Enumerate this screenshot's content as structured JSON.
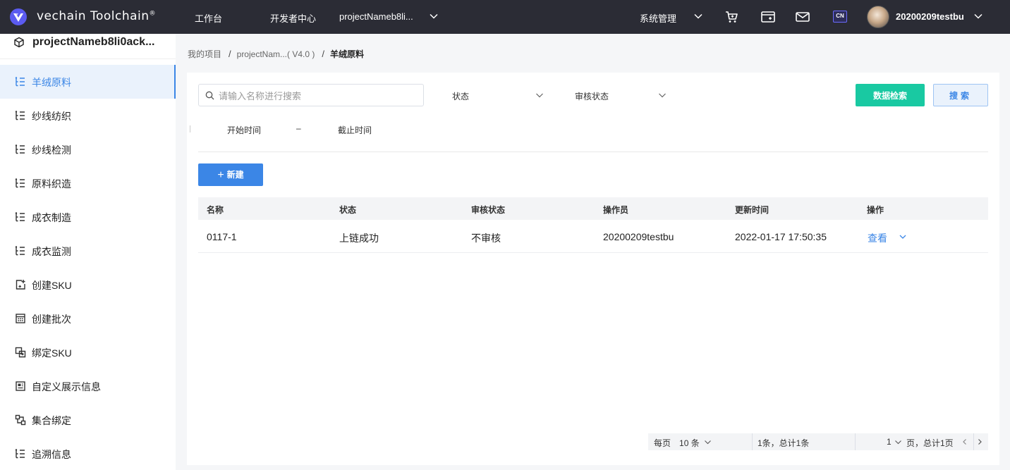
{
  "topbar": {
    "brand": "vechain Toolchain",
    "brand_mark": "®",
    "nav": {
      "workbench": "工作台",
      "dev_center": "开发者中心",
      "project_select": "projectNameb8li..."
    },
    "system_manage": "系统管理",
    "lang_badge": "CN",
    "username": "20200209testbu"
  },
  "sidebar": {
    "project_name": "projectNameb8li0ack...",
    "items": [
      {
        "label": "羊绒原料",
        "icon": "list-tree-icon"
      },
      {
        "label": "纱线纺织",
        "icon": "list-tree-icon"
      },
      {
        "label": "纱线检测",
        "icon": "list-tree-icon"
      },
      {
        "label": "原料织造",
        "icon": "list-tree-icon"
      },
      {
        "label": "成衣制造",
        "icon": "list-tree-icon"
      },
      {
        "label": "成衣监测",
        "icon": "list-tree-icon"
      },
      {
        "label": "创建SKU",
        "icon": "create-sku-icon"
      },
      {
        "label": "创建批次",
        "icon": "calendar-grid-icon"
      },
      {
        "label": "绑定SKU",
        "icon": "bind-icon"
      },
      {
        "label": "自定义展示信息",
        "icon": "display-info-icon"
      },
      {
        "label": "集合绑定",
        "icon": "collection-bind-icon"
      },
      {
        "label": "追溯信息",
        "icon": "list-tree-icon"
      }
    ],
    "active_index": 0
  },
  "breadcrumb": {
    "root": "我的项目",
    "project": "projectNam...( V4.0 )",
    "current": "羊绒原料",
    "separator": "/"
  },
  "filters": {
    "search_placeholder": "请输入名称进行搜索",
    "status_label": "状态",
    "audit_label": "审核状态",
    "data_search_button": "数据检索",
    "search_button": "搜索",
    "start_time": "开始时间",
    "range_dash": "–",
    "end_time": "截止时间"
  },
  "actions": {
    "new_button": "新建"
  },
  "table": {
    "columns": [
      "名称",
      "状态",
      "审核状态",
      "操作员",
      "更新时间",
      "操作"
    ],
    "rows": [
      {
        "name": "0117-1",
        "status": "上链成功",
        "audit": "不审核",
        "operator": "20200209testbu",
        "updated": "2022-01-17 17:50:35",
        "action": "查看"
      }
    ]
  },
  "pagination": {
    "per_page_label": "每页",
    "per_page_value": "10 条",
    "total_text": "1条，总计1条",
    "page_value": "1",
    "page_total_text": "页，总计1页"
  },
  "colors": {
    "topbar_bg": "#2b2c35",
    "accent_blue": "#3b86e6",
    "accent_green": "#19c9a2",
    "active_bg": "#eaf2fc"
  }
}
